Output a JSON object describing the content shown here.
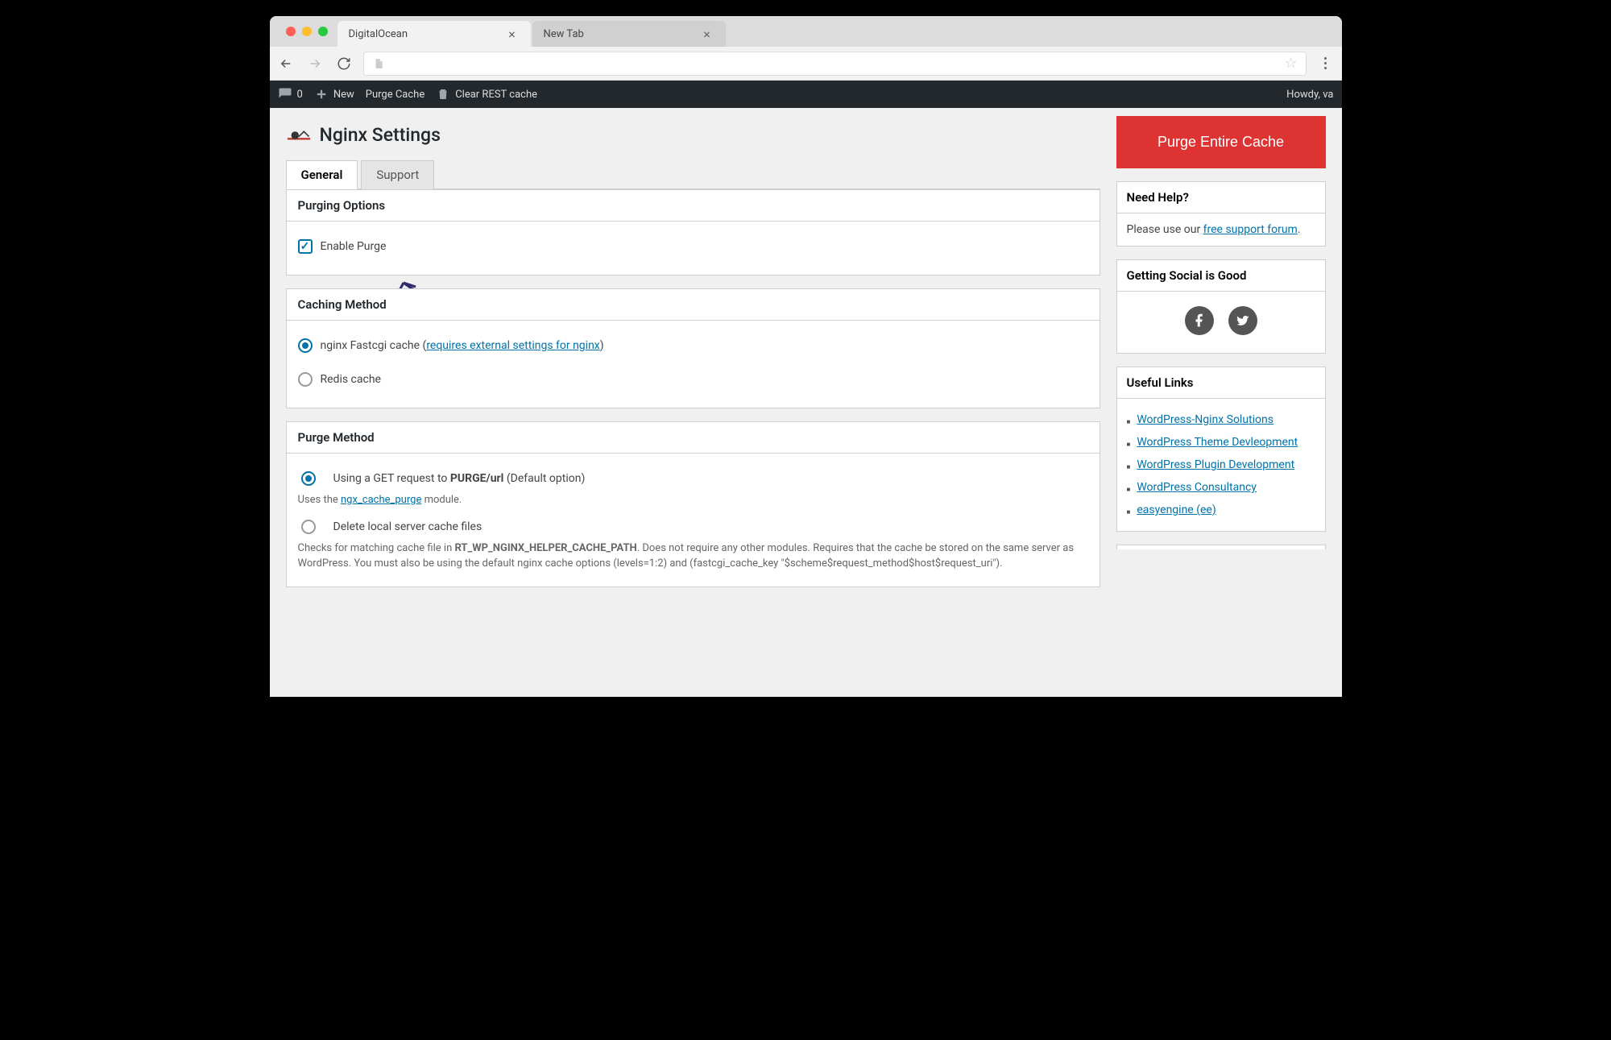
{
  "browser": {
    "tabs": [
      {
        "title": "DigitalOcean",
        "active": true
      },
      {
        "title": "New Tab",
        "active": false
      }
    ]
  },
  "adminbar": {
    "comment_count": "0",
    "new_label": "New",
    "purge_cache_label": "Purge Cache",
    "clear_rest_label": "Clear REST cache",
    "howdy": "Howdy, va"
  },
  "page": {
    "title": "Nginx Settings",
    "tabs": {
      "general": "General",
      "support": "Support"
    }
  },
  "purging": {
    "heading": "Purging Options",
    "enable_label": "Enable Purge"
  },
  "caching": {
    "heading": "Caching Method",
    "fastcgi_prefix": "nginx Fastcgi cache (",
    "fastcgi_link": "requires external settings for nginx",
    "fastcgi_suffix": ")",
    "redis_label": "Redis cache"
  },
  "purge_method": {
    "heading": "Purge Method",
    "get_prefix": "Using a GET request to ",
    "get_bold": "PURGE/url",
    "get_suffix": " (Default option)",
    "get_help_prefix": "Uses the ",
    "get_help_link": "ngx_cache_purge",
    "get_help_suffix": " module.",
    "delete_label": "Delete local server cache files",
    "delete_help_prefix": "Checks for matching cache file in ",
    "delete_help_bold": "RT_WP_NGINX_HELPER_CACHE_PATH",
    "delete_help_suffix": ". Does not require any other modules. Requires that the cache be stored on the same server as WordPress. You must also be using the default nginx cache options (levels=1:2) and (fastcgi_cache_key \"$scheme$request_method$host$request_uri\")."
  },
  "sidebar": {
    "purge_button": "Purge Entire Cache",
    "need_help": {
      "heading": "Need Help?",
      "text_prefix": "Please use our ",
      "link": "free support forum",
      "text_suffix": "."
    },
    "social_heading": "Getting Social is Good",
    "useful_heading": "Useful Links",
    "useful_links": [
      "WordPress-Nginx Solutions",
      "WordPress Theme Devleopment",
      "WordPress Plugin Development",
      "WordPress Consultancy",
      "easyengine (ee)"
    ]
  }
}
